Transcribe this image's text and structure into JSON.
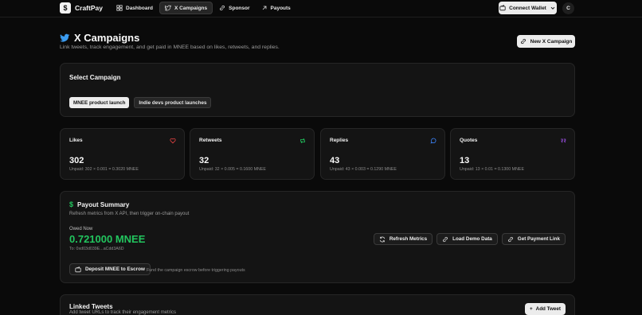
{
  "app": {
    "logo_glyph": "$",
    "name": "CraftPay"
  },
  "nav": {
    "links": [
      {
        "label": "Dashboard",
        "icon": "dashboard-icon"
      },
      {
        "label": "X Campaigns",
        "icon": "twitter-icon",
        "active": true
      },
      {
        "label": "Sponsor",
        "icon": "link-icon"
      },
      {
        "label": "Payouts",
        "icon": "arrow-up-right-icon"
      }
    ],
    "wallet_label": "Connect Wallet",
    "avatar_initial": "C"
  },
  "header": {
    "title": "X Campaigns",
    "subtitle": "Link tweets, track engagement, and get paid in MNEE based on likes, retweets, and replies.",
    "new_campaign_label": "New X Campaign"
  },
  "select_campaign": {
    "title": "Select Campaign",
    "campaigns": [
      {
        "label": "MNEE product launch",
        "selected": true
      },
      {
        "label": "Indie devs product launches",
        "selected": false
      }
    ]
  },
  "metrics": [
    {
      "label": "Likes",
      "value": "302",
      "note": "Unpaid: 302 × 0.001 = 0.3020 MNEE",
      "icon": "heart-icon",
      "color": "#ef4444"
    },
    {
      "label": "Retweets",
      "value": "32",
      "note": "Unpaid: 32 × 0.005 = 0.1600 MNEE",
      "icon": "retweet-icon",
      "color": "#22c55e"
    },
    {
      "label": "Replies",
      "value": "43",
      "note": "Unpaid: 43 × 0.003 = 0.1290 MNEE",
      "icon": "reply-icon",
      "color": "#3b82f6"
    },
    {
      "label": "Quotes",
      "value": "13",
      "note": "Unpaid: 13 × 0.01 = 0.1300 MNEE",
      "icon": "quote-icon",
      "color": "#a855f7"
    }
  ],
  "payout": {
    "title": "Payout Summary",
    "icon_glyph": "$",
    "description": "Refresh metrics from X API, then trigger on-chain payout",
    "owed_label": "Owed Now",
    "owed_value": "0.721000 MNEE",
    "to": "To: 0xd03d039E...aCdd3A6D",
    "refresh_label": "Refresh Metrics",
    "demo_label": "Load Demo Data",
    "payment_link_label": "Get Payment Link",
    "deposit_label": "Deposit MNEE to Escrow",
    "deposit_hint": "Fund the campaign escrow before triggering payouts"
  },
  "linked_tweets": {
    "title": "Linked Tweets",
    "description": "Add tweet URLs to track their engagement metrics",
    "add_label": "Add Tweet",
    "add_glyph": "+"
  },
  "colors": {
    "accent_green": "#22c55e",
    "twitter_blue": "#3b9bf0"
  }
}
